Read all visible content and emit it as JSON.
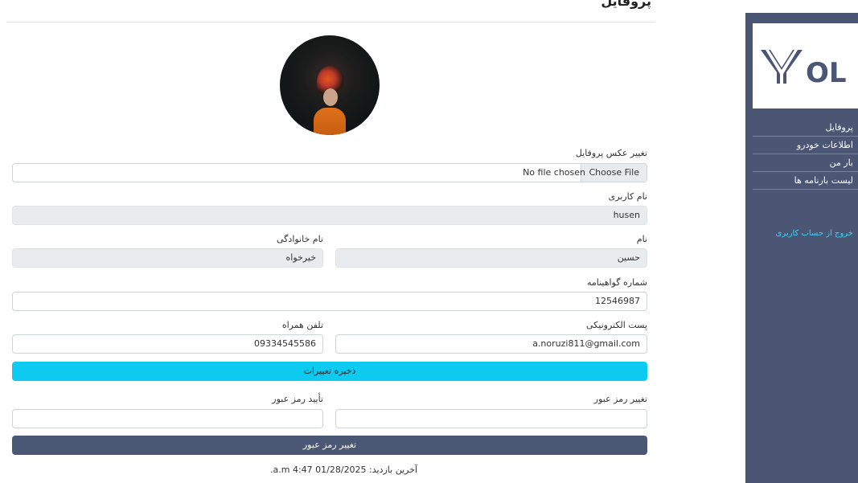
{
  "page": {
    "title": "پروفایل"
  },
  "profile_photo": {
    "label": "تغییر عکس پروفایل",
    "choose_button": "Choose File",
    "no_file_text": "No file chosen"
  },
  "username": {
    "label": "نام کاربری",
    "value": "husen"
  },
  "first_name": {
    "label": "نام",
    "value": "حسین"
  },
  "last_name": {
    "label": "نام خانوادگی",
    "value": "خیرخواه"
  },
  "license": {
    "label": "شماره گواهینامه",
    "value": "12546987"
  },
  "email": {
    "label": "پست الکترونیکی",
    "value": "a.noruzi811@gmail.com"
  },
  "phone": {
    "label": "تلفن همراه",
    "value": "09334545586"
  },
  "save_button": "ذخیره تغییرات",
  "new_password": {
    "label": "تغییر رمز عبور",
    "value": ""
  },
  "confirm_password": {
    "label": "تأیید رمز عبور",
    "value": ""
  },
  "change_password_button": "تغییر رمز عبور",
  "last_visit": "آخرین بازدید: 01/28/2025 4:47 a.m.",
  "sidebar": {
    "logo_text": "OL",
    "items": [
      {
        "label": "پروفایل"
      },
      {
        "label": "اطلاعات خودرو"
      },
      {
        "label": "بار من"
      },
      {
        "label": "لیست بارنامه ها"
      }
    ],
    "logout": "خروج از حساب کاربری"
  },
  "colors": {
    "sidebar": "#4a5674",
    "save": "#0dcaf0",
    "password_button": "#4a5875",
    "logout": "#3fd2f5"
  }
}
